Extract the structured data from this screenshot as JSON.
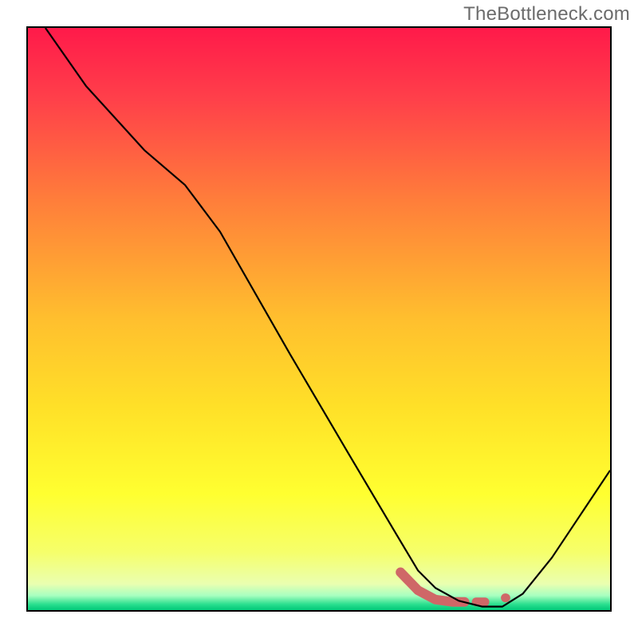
{
  "watermark": "TheBottleneck.com",
  "chart_data": {
    "type": "line",
    "title": "",
    "xlabel": "",
    "ylabel": "",
    "xlim": [
      0,
      100
    ],
    "ylim": [
      0,
      100
    ],
    "series": [
      {
        "name": "curve",
        "color": "#000000",
        "width": 2.2,
        "points": [
          {
            "x": 3.0,
            "y": 100.0
          },
          {
            "x": 10.0,
            "y": 90.0
          },
          {
            "x": 20.0,
            "y": 79.0
          },
          {
            "x": 27.0,
            "y": 73.0
          },
          {
            "x": 33.0,
            "y": 65.0
          },
          {
            "x": 45.0,
            "y": 44.0
          },
          {
            "x": 55.0,
            "y": 27.0
          },
          {
            "x": 63.0,
            "y": 13.5
          },
          {
            "x": 67.0,
            "y": 6.8
          },
          {
            "x": 70.0,
            "y": 3.8
          },
          {
            "x": 74.0,
            "y": 1.6
          },
          {
            "x": 78.0,
            "y": 0.6
          },
          {
            "x": 81.5,
            "y": 0.6
          },
          {
            "x": 85.0,
            "y": 2.8
          },
          {
            "x": 90.0,
            "y": 9.0
          },
          {
            "x": 95.0,
            "y": 16.5
          },
          {
            "x": 100.0,
            "y": 24.0
          }
        ]
      },
      {
        "name": "highlight-main",
        "color": "#cf6767",
        "width": 12,
        "cap": "round",
        "points": [
          {
            "x": 64.0,
            "y": 6.5
          },
          {
            "x": 67.0,
            "y": 3.4
          },
          {
            "x": 70.0,
            "y": 1.8
          },
          {
            "x": 73.0,
            "y": 1.4
          },
          {
            "x": 75.0,
            "y": 1.4
          }
        ]
      },
      {
        "name": "highlight-seg2",
        "color": "#cf6767",
        "width": 11,
        "cap": "round",
        "points": [
          {
            "x": 77.0,
            "y": 1.4
          },
          {
            "x": 78.5,
            "y": 1.4
          }
        ]
      },
      {
        "name": "highlight-dot",
        "color": "#cf6767",
        "width": 11,
        "cap": "round",
        "points": [
          {
            "x": 82.0,
            "y": 2.1
          },
          {
            "x": 82.1,
            "y": 2.1
          }
        ]
      }
    ],
    "background": {
      "type": "vertical-gradient",
      "stops": [
        {
          "pos": 0.0,
          "color": "#ff1a4a"
        },
        {
          "pos": 0.12,
          "color": "#ff3f4a"
        },
        {
          "pos": 0.3,
          "color": "#ff7f3a"
        },
        {
          "pos": 0.5,
          "color": "#ffbf2e"
        },
        {
          "pos": 0.65,
          "color": "#ffe028"
        },
        {
          "pos": 0.8,
          "color": "#ffff30"
        },
        {
          "pos": 0.9,
          "color": "#f6ff6a"
        },
        {
          "pos": 0.955,
          "color": "#eaffb0"
        },
        {
          "pos": 0.975,
          "color": "#a8ffc0"
        },
        {
          "pos": 0.99,
          "color": "#2bdf8f"
        },
        {
          "pos": 1.0,
          "color": "#00c878"
        }
      ]
    }
  }
}
